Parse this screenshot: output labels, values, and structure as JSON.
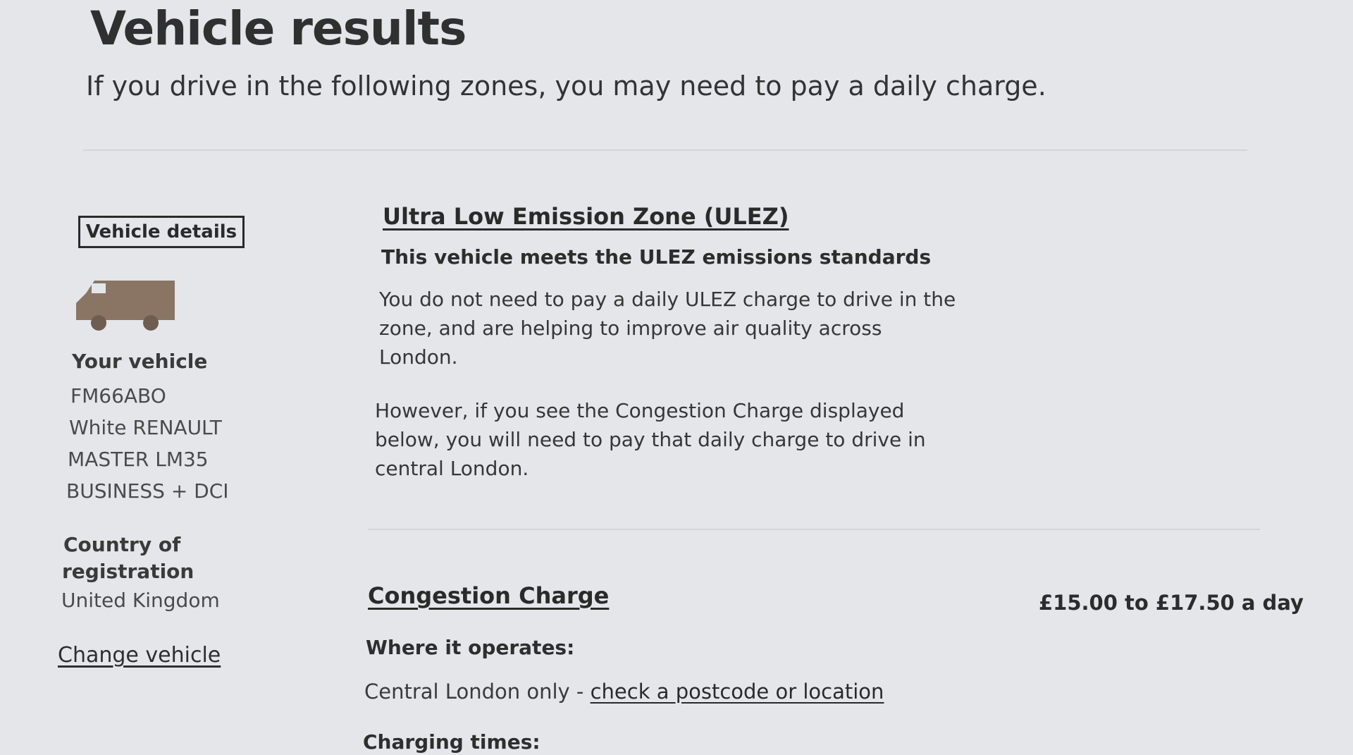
{
  "header": {
    "title": "Vehicle results",
    "subtitle": "If you drive in the following zones, you may need to pay a daily charge."
  },
  "sidebar": {
    "tag": "Vehicle details",
    "vehicle_icon": "van-icon",
    "your_vehicle_label": "Your vehicle",
    "vehicle_lines": [
      "FM66ABO",
      "White RENAULT",
      "MASTER LM35",
      "BUSINESS + DCI"
    ],
    "country_label_line1": "Country of",
    "country_label_line2": "registration",
    "country_value": "United Kingdom",
    "change_link": "Change vehicle"
  },
  "ulez": {
    "title": "Ultra Low Emission Zone (ULEZ)",
    "status": "This vehicle meets the ULEZ emissions standards",
    "body1": "You do not need to pay a daily ULEZ charge to drive in the zone, and are helping to improve air quality across London.",
    "body2": "However, if you see the Congestion Charge displayed below, you will need to pay that daily charge to drive in central London."
  },
  "congestion": {
    "title": "Congestion Charge",
    "price": "£15.00 to £17.50 a day",
    "where_label": "Where it operates:",
    "where_text": "Central London only - ",
    "postcode_link": "check a postcode or location",
    "times_label": "Charging times:"
  },
  "colors": {
    "background": "#e4e6ea",
    "van": "#8a7565",
    "text": "#2b2b2b"
  }
}
